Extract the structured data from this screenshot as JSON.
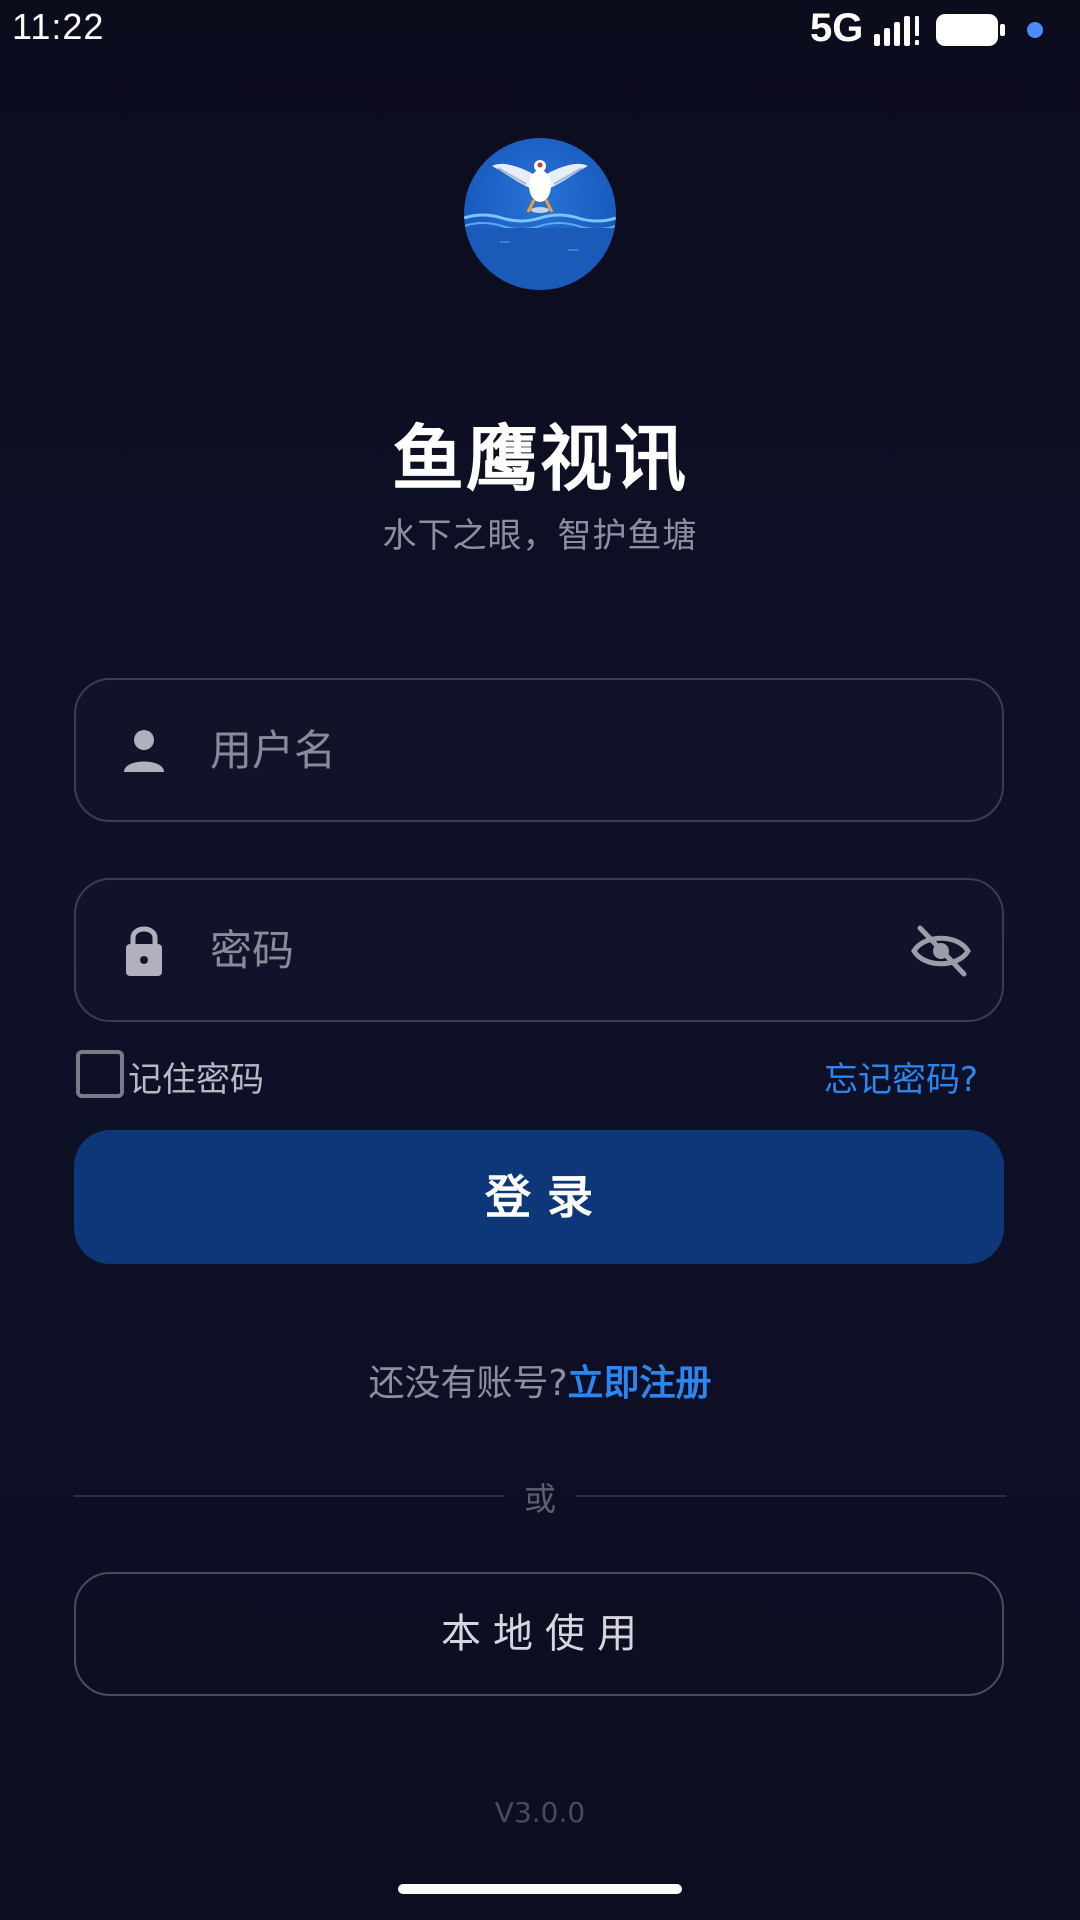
{
  "status_bar": {
    "time": "11:22",
    "network": "5G",
    "icons": [
      "signal-icon",
      "battery-icon",
      "notification-dot-icon"
    ],
    "dot_color": "#4a8cff"
  },
  "app": {
    "logo_icon": "osprey-over-water-logo",
    "title": "鱼鹰视讯",
    "subtitle": "水下之眼，智护鱼塘"
  },
  "login_form": {
    "username": {
      "placeholder": "用户名",
      "value": "",
      "icon": "person-icon"
    },
    "password": {
      "placeholder": "密码",
      "value": "",
      "icon": "lock-icon",
      "toggle_icon": "eye-off-icon"
    },
    "remember": {
      "label": "记住密码",
      "checked": false
    },
    "forgot_label": "忘记密码?",
    "login_label": "登录"
  },
  "register": {
    "prompt": "还没有账号?",
    "link": "立即注册"
  },
  "divider_text": "或",
  "local_use_label": "本地使用",
  "version": "V3.0.0",
  "colors": {
    "accent": "#2b86f0",
    "primary_button": "#0d3779",
    "background": "#0f1129"
  }
}
